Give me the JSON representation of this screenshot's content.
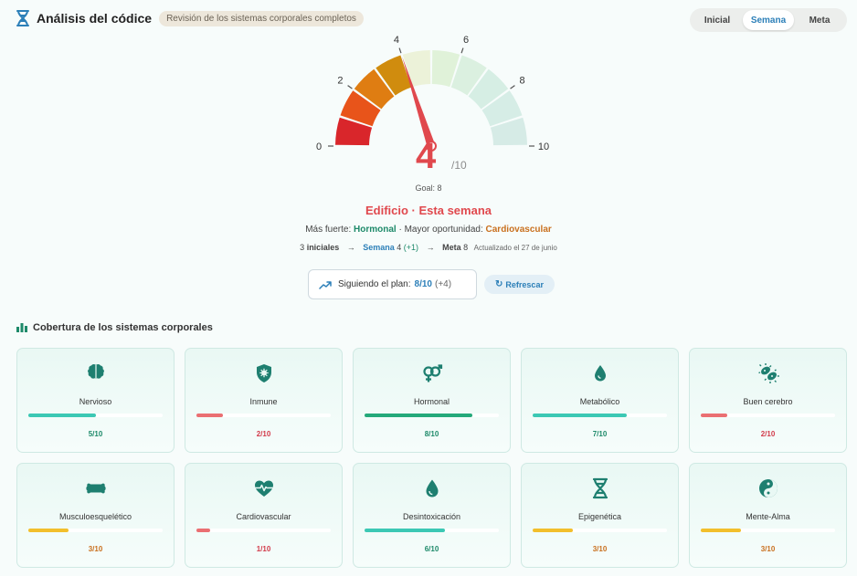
{
  "header": {
    "title": "Análisis del códice",
    "subtitle": "Revisión de los sistemas corporales completos",
    "segments": [
      "Inicial",
      "Semana",
      "Meta"
    ],
    "active_segment": "Semana"
  },
  "gauge": {
    "value": 4,
    "max": 10,
    "score_text": "4",
    "denominator_text": "/10",
    "tick_labels": [
      "0",
      "2",
      "4",
      "6",
      "8",
      "10"
    ],
    "goal_text": "Goal: 8",
    "segment_colors": [
      "#d9262b",
      "#e8541a",
      "#df7d12",
      "#d08c0e",
      "#ecf2d9",
      "#e0f2d9",
      "#dbf0e0",
      "#d6eee4",
      "#d6ede6",
      "#d6ebe6"
    ]
  },
  "summary": {
    "title": "Edificio · Esta semana",
    "strong_label": "Más fuerte: ",
    "strong_value": "Hormonal",
    "sep": " · Mayor oportunidad: ",
    "opp_value": "Cardiovascular",
    "baseline_num": "3",
    "baseline_label": " iniciales",
    "arrow": "→",
    "week_label": "Semana",
    "week_val": " 4",
    "week_delta": " (+1)",
    "goal_label": "Meta",
    "goal_val": " 8",
    "updated": "Actualizado el 27 de junio"
  },
  "plan": {
    "label": "Siguiendo el plan:",
    "value": "8/10",
    "delta": "(+4)",
    "refresh_label": "Refrescar"
  },
  "coverage": {
    "title": "Cobertura de los sistemas corporales",
    "cards": [
      {
        "name": "Nervioso",
        "score": "5/10",
        "value": 5,
        "icon": "brain-icon",
        "color": "#3cc8b4",
        "text_color": "#1e8a6a"
      },
      {
        "name": "Inmune",
        "score": "2/10",
        "value": 2,
        "icon": "shield-virus-icon",
        "color": "#ea6f72",
        "text_color": "#d23a4a"
      },
      {
        "name": "Hormonal",
        "score": "8/10",
        "value": 8,
        "icon": "gender-icon",
        "color": "#25a97a",
        "text_color": "#1e8a6a"
      },
      {
        "name": "Metabólico",
        "score": "7/10",
        "value": 7,
        "icon": "droplet-icon",
        "color": "#3cc8b4",
        "text_color": "#1e8a6a"
      },
      {
        "name": "Buen cerebro",
        "score": "2/10",
        "value": 2,
        "icon": "bacteria-icon",
        "color": "#ea6f72",
        "text_color": "#d23a4a"
      },
      {
        "name": "Musculoesquelético",
        "score": "3/10",
        "value": 3,
        "icon": "bone-icon",
        "color": "#f2bf2c",
        "text_color": "#c9701f"
      },
      {
        "name": "Cardiovascular",
        "score": "1/10",
        "value": 1,
        "icon": "heart-pulse-icon",
        "color": "#ea6f72",
        "text_color": "#d23a4a"
      },
      {
        "name": "Desintoxicación",
        "score": "6/10",
        "value": 6,
        "icon": "water-drop-icon",
        "color": "#3cc8b4",
        "text_color": "#1e8a6a"
      },
      {
        "name": "Epigenética",
        "score": "3/10",
        "value": 3,
        "icon": "dna-icon",
        "color": "#f2bf2c",
        "text_color": "#c9701f"
      },
      {
        "name": "Mente-Alma",
        "score": "3/10",
        "value": 3,
        "icon": "yin-yang-icon",
        "color": "#f2bf2c",
        "text_color": "#c9701f"
      }
    ]
  }
}
